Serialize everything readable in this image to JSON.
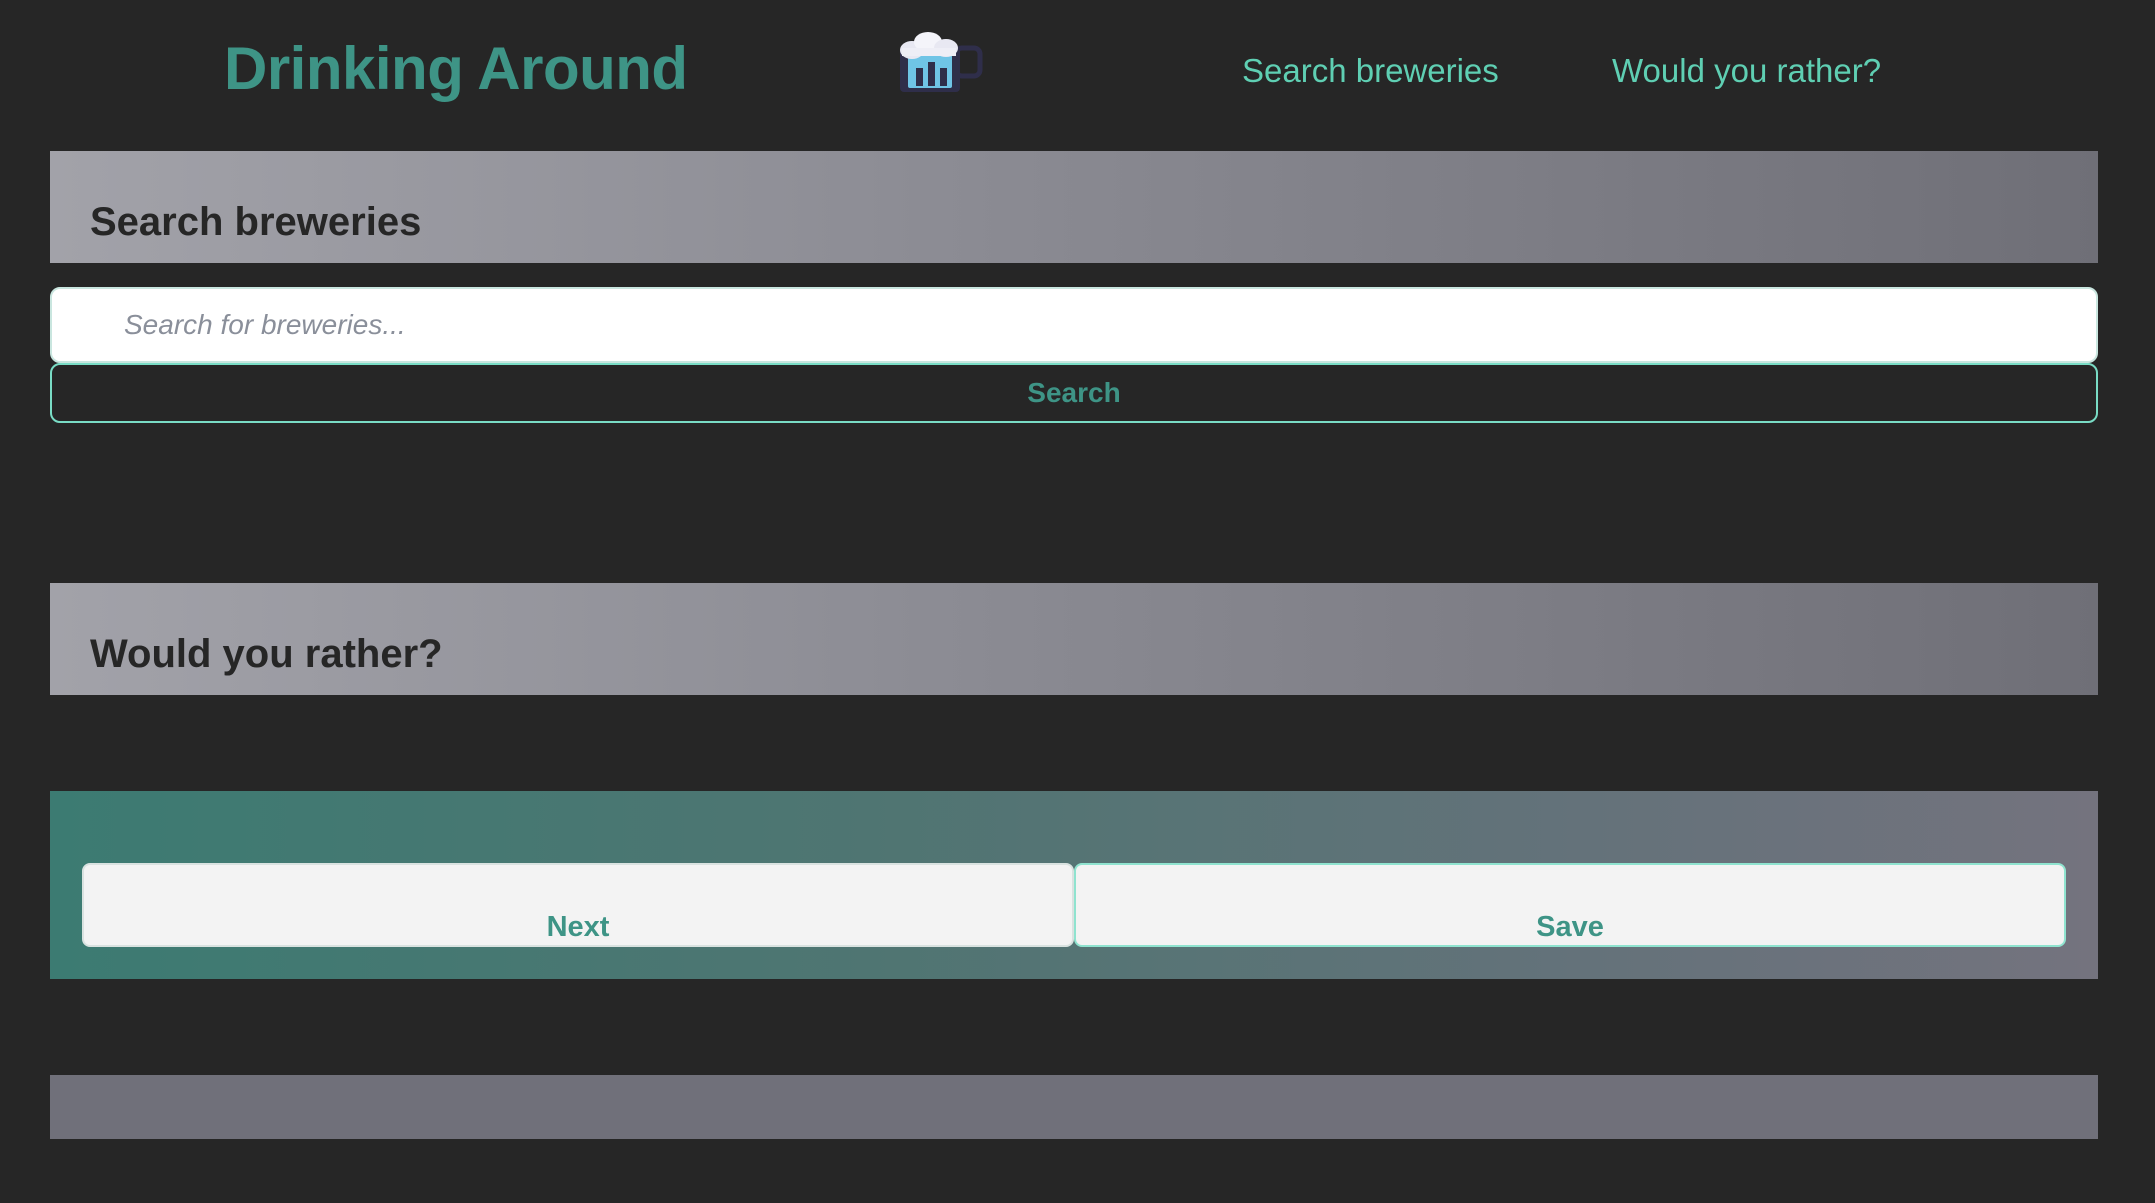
{
  "header": {
    "brand": "Drinking Around",
    "logo_icon": "beer-mug-icon",
    "nav": [
      {
        "label": "Search breweries"
      },
      {
        "label": "Would you rather?"
      }
    ]
  },
  "search_section": {
    "title": "Search breweries",
    "input_placeholder": "Search for breweries...",
    "input_value": "",
    "button_label": "Search"
  },
  "wyr_section": {
    "title": "Would you rather?",
    "next_label": "Next",
    "save_label": "Save"
  },
  "colors": {
    "background": "#262626",
    "accent": "#3e9486",
    "nav_link": "#5fcfb3",
    "button_border": "#79dcc5"
  }
}
